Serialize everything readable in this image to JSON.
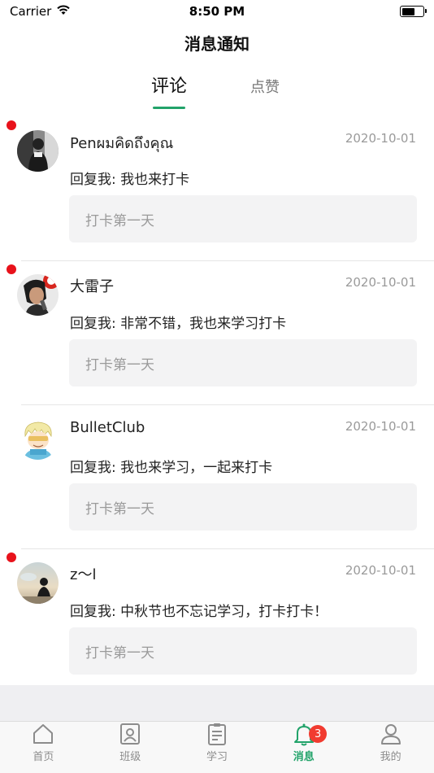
{
  "status_bar": {
    "carrier": "Carrier",
    "time": "8:50 PM"
  },
  "nav": {
    "title": "消息通知"
  },
  "tabs": [
    {
      "label": "评论",
      "active": true
    },
    {
      "label": "点赞",
      "active": false
    }
  ],
  "messages": [
    {
      "name": "Penผมคิดถึงคุณ",
      "date": "2020-10-01",
      "reply": "回复我: 我也来打卡",
      "quote": "打卡第一天",
      "unread": true,
      "avatar": "bw-portrait-avatar"
    },
    {
      "name": "大雷子",
      "date": "2020-10-01",
      "reply": "回复我: 非常不错，我也来学习打卡",
      "quote": "打卡第一天",
      "unread": true,
      "avatar": "singer-portrait-avatar"
    },
    {
      "name": "BulletClub",
      "date": "2020-10-01",
      "reply": "回复我: 我也来学习，一起来打卡",
      "quote": "打卡第一天",
      "unread": false,
      "avatar": "cartoon-boy-avatar"
    },
    {
      "name": "z～l",
      "date": "2020-10-01",
      "reply": "回复我: 中秋节也不忘记学习，打卡打卡！",
      "quote": "打卡第一天",
      "unread": true,
      "avatar": "sunset-silhouette-avatar"
    }
  ],
  "tabbar": {
    "items": [
      {
        "label": "首页",
        "icon": "home-icon",
        "active": false
      },
      {
        "label": "班级",
        "icon": "class-icon",
        "active": false
      },
      {
        "label": "学习",
        "icon": "clipboard-icon",
        "active": false
      },
      {
        "label": "消息",
        "icon": "bell-icon",
        "active": true,
        "badge": "3"
      },
      {
        "label": "我的",
        "icon": "person-icon",
        "active": false
      }
    ]
  },
  "colors": {
    "accent": "#22a36a",
    "unread": "#e8121b",
    "badge": "#f13b30"
  }
}
